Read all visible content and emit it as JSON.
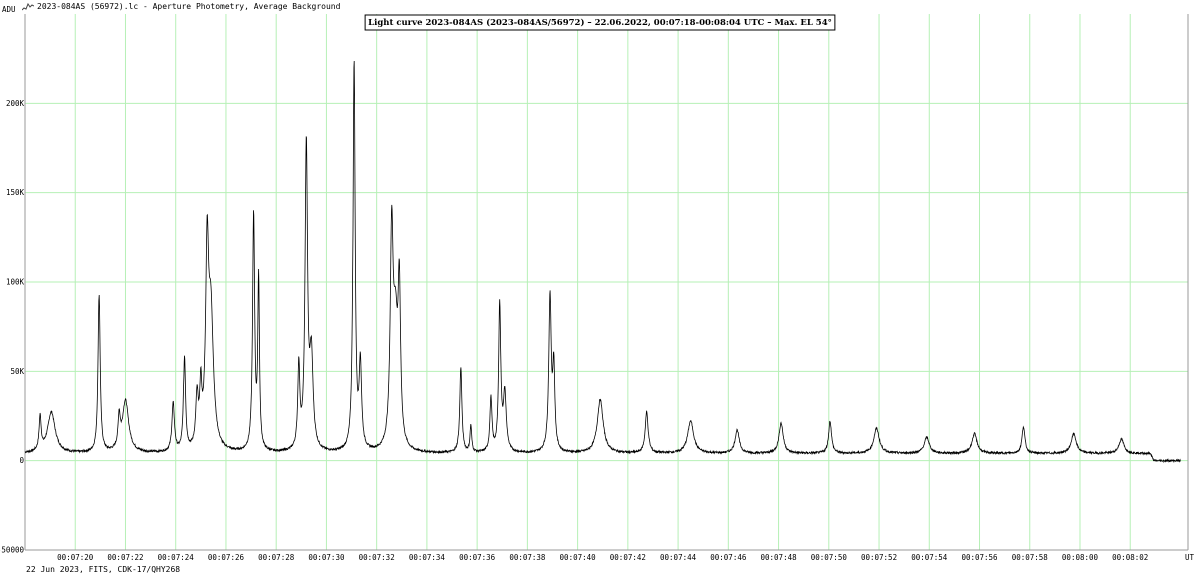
{
  "window": {
    "title": "2023-084AS (56972).lc - Aperture Photometry, Average Background"
  },
  "footer": {
    "text": "22 Jun 2023, FITS, CDK-17/QHY268"
  },
  "colors": {
    "grid": "#b6f0b6",
    "axis": "#9a9a9a",
    "line": "#000000",
    "background": "#ffffff"
  },
  "icons": {
    "window": "chart-icon"
  },
  "chart_data": {
    "type": "line",
    "title": "Light curve 2023-084AS (2023-084AS/56972) – 22.06.2022, 00:07:18-00:08:04 UTC – Max. EL 54°",
    "xlabel": "UT",
    "ylabel": "ADU",
    "grid": true,
    "legend": "none",
    "xlim_seconds": [
      438,
      484.3
    ],
    "ylim": [
      -50000,
      250000
    ],
    "y_ticks": [
      -50000,
      0,
      50000,
      100000,
      150000,
      200000
    ],
    "y_tick_labels": [
      "-50000",
      "0",
      "50K",
      "100K",
      "150K",
      "200K"
    ],
    "x_ticks_seconds": [
      440,
      442,
      444,
      446,
      448,
      450,
      452,
      454,
      456,
      458,
      460,
      462,
      464,
      466,
      468,
      470,
      472,
      474,
      476,
      478,
      480,
      482
    ],
    "x_tick_labels": [
      "00:07:20",
      "00:07:22",
      "00:07:24",
      "00:07:26",
      "00:07:28",
      "00:07:30",
      "00:07:32",
      "00:07:34",
      "00:07:36",
      "00:07:38",
      "00:07:40",
      "00:07:42",
      "00:07:44",
      "00:07:46",
      "00:07:48",
      "00:07:50",
      "00:07:52",
      "00:07:54",
      "00:07:56",
      "00:07:58",
      "00:08:00",
      "00:08:02"
    ],
    "series": [
      {
        "baseline": 4000,
        "peaks": [
          {
            "t": 438.6,
            "a": 19000,
            "w": 0.05
          },
          {
            "t": 439.05,
            "a": 23000,
            "w": 0.18
          },
          {
            "t": 440.95,
            "a": 88000,
            "w": 0.05
          },
          {
            "t": 441.75,
            "a": 17000,
            "w": 0.05
          },
          {
            "t": 442.0,
            "a": 29000,
            "w": 0.15
          },
          {
            "t": 443.9,
            "a": 27000,
            "w": 0.06
          },
          {
            "t": 444.35,
            "a": 52000,
            "w": 0.05
          },
          {
            "t": 444.85,
            "a": 28000,
            "w": 0.06
          },
          {
            "t": 445.0,
            "a": 30000,
            "w": 0.05
          },
          {
            "t": 445.25,
            "a": 102000,
            "w": 0.07
          },
          {
            "t": 445.4,
            "a": 75000,
            "w": 0.12
          },
          {
            "t": 447.1,
            "a": 132000,
            "w": 0.05
          },
          {
            "t": 447.3,
            "a": 95000,
            "w": 0.04
          },
          {
            "t": 448.9,
            "a": 46000,
            "w": 0.05
          },
          {
            "t": 449.2,
            "a": 170000,
            "w": 0.06
          },
          {
            "t": 449.4,
            "a": 50000,
            "w": 0.08
          },
          {
            "t": 451.1,
            "a": 218000,
            "w": 0.05
          },
          {
            "t": 451.35,
            "a": 47000,
            "w": 0.06
          },
          {
            "t": 452.6,
            "a": 117000,
            "w": 0.07
          },
          {
            "t": 452.9,
            "a": 84000,
            "w": 0.06
          },
          {
            "t": 452.75,
            "a": 60000,
            "w": 0.1
          },
          {
            "t": 455.35,
            "a": 48000,
            "w": 0.05
          },
          {
            "t": 455.75,
            "a": 15000,
            "w": 0.04
          },
          {
            "t": 456.55,
            "a": 30000,
            "w": 0.05
          },
          {
            "t": 456.9,
            "a": 82000,
            "w": 0.05
          },
          {
            "t": 457.1,
            "a": 32000,
            "w": 0.07
          },
          {
            "t": 458.9,
            "a": 86000,
            "w": 0.06
          },
          {
            "t": 459.05,
            "a": 45000,
            "w": 0.05
          },
          {
            "t": 460.9,
            "a": 30000,
            "w": 0.14
          },
          {
            "t": 462.75,
            "a": 23000,
            "w": 0.07
          },
          {
            "t": 464.5,
            "a": 18000,
            "w": 0.14
          },
          {
            "t": 466.35,
            "a": 13000,
            "w": 0.1
          },
          {
            "t": 468.1,
            "a": 17000,
            "w": 0.1
          },
          {
            "t": 470.05,
            "a": 18000,
            "w": 0.07
          },
          {
            "t": 471.9,
            "a": 14000,
            "w": 0.13
          },
          {
            "t": 473.9,
            "a": 9000,
            "w": 0.12
          },
          {
            "t": 475.8,
            "a": 11000,
            "w": 0.12
          },
          {
            "t": 477.75,
            "a": 15000,
            "w": 0.07
          },
          {
            "t": 479.75,
            "a": 11000,
            "w": 0.12
          },
          {
            "t": 481.65,
            "a": 8000,
            "w": 0.12
          }
        ],
        "tail": {
          "t_start": 482.8,
          "t_end": 484.0,
          "value": 0
        }
      }
    ]
  }
}
